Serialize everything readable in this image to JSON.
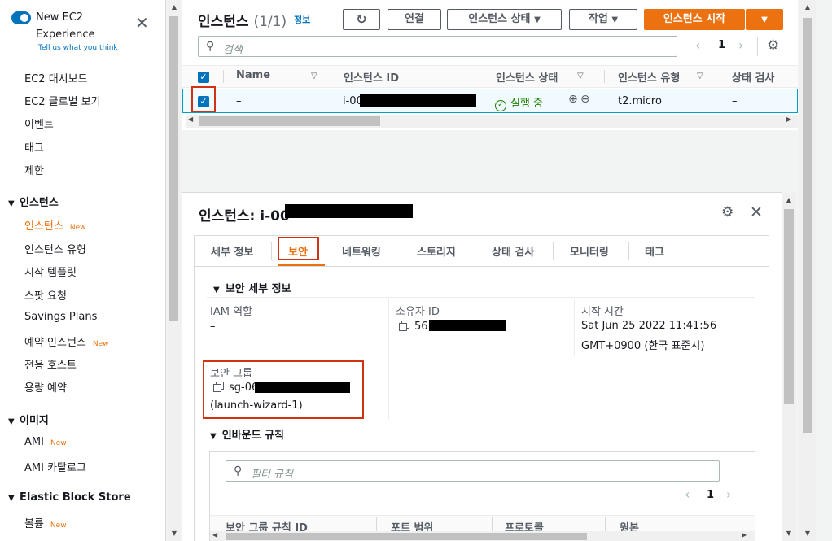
{
  "sidebar": {
    "toggle_title_line1": "New EC2",
    "toggle_title_line2": "Experience",
    "toggle_subtitle": "Tell us what you think",
    "items": [
      {
        "label": "EC2 대시보드"
      },
      {
        "label": "EC2 글로벌 보기"
      },
      {
        "label": "이벤트"
      },
      {
        "label": "태그"
      },
      {
        "label": "제한"
      }
    ],
    "sections": [
      {
        "label": "인스턴스"
      },
      {
        "label": "이미지"
      },
      {
        "label": "Elastic Block Store"
      }
    ],
    "instances_items": [
      {
        "label": "인스턴스",
        "badge": "New"
      },
      {
        "label": "인스턴스 유형"
      },
      {
        "label": "시작 템플릿"
      },
      {
        "label": "스팟 요청"
      },
      {
        "label": "Savings Plans"
      },
      {
        "label": "예약 인스턴스",
        "badge": "New"
      },
      {
        "label": "전용 호스트"
      },
      {
        "label": "용량 예약"
      }
    ],
    "images_items": [
      {
        "label": "AMI",
        "badge": "New"
      },
      {
        "label": "AMI 카탈로그"
      }
    ],
    "ebs_items": [
      {
        "label": "볼륨",
        "badge": "New"
      }
    ]
  },
  "instances_panel": {
    "title": "인스턴스",
    "count": "(1/1)",
    "info_link": "정보",
    "buttons": {
      "connect": "연결",
      "instance_state": "인스턴스 상태",
      "actions": "작업",
      "launch": "인스턴스 시작"
    },
    "search_placeholder": "검색",
    "page_number": "1",
    "columns": [
      "Name",
      "인스턴스 ID",
      "인스턴스 상태",
      "인스턴스 유형",
      "상태 검사"
    ],
    "rows": [
      {
        "name": "–",
        "instance_id": "i-00",
        "state": "실행 중",
        "type": "t2.micro",
        "status_check": "–"
      }
    ]
  },
  "detail_panel": {
    "title_prefix": "인스턴스: ",
    "title_id": "i-00",
    "tabs": [
      "세부 정보",
      "보안",
      "네트워킹",
      "스토리지",
      "상태 검사",
      "모니터링",
      "태그"
    ],
    "active_tab": "보안",
    "security_section_title": "보안 세부 정보",
    "iam_role_label": "IAM 역할",
    "iam_role_value": "–",
    "owner_id_label": "소유자 ID",
    "owner_id_value": "56",
    "launch_time_label": "시작 시간",
    "launch_time_line1": "Sat Jun 25 2022 11:41:56",
    "launch_time_line2": "GMT+0900 (한국 표준시)",
    "security_groups_label": "보안 그룹",
    "security_group_id": "sg-06",
    "security_group_name": "(launch-wizard-1)",
    "inbound_title": "인바운드 규칙",
    "filter_placeholder": "필터 규칙",
    "inbound_page": "1",
    "inbound_columns": [
      "보안 그룹 규칙 ID",
      "포트 범위",
      "프로토콜",
      "원본"
    ]
  },
  "colors": {
    "accent": "#ec7211",
    "link": "#0073bb",
    "success": "#1d8102",
    "highlight_box": "#d13212"
  }
}
